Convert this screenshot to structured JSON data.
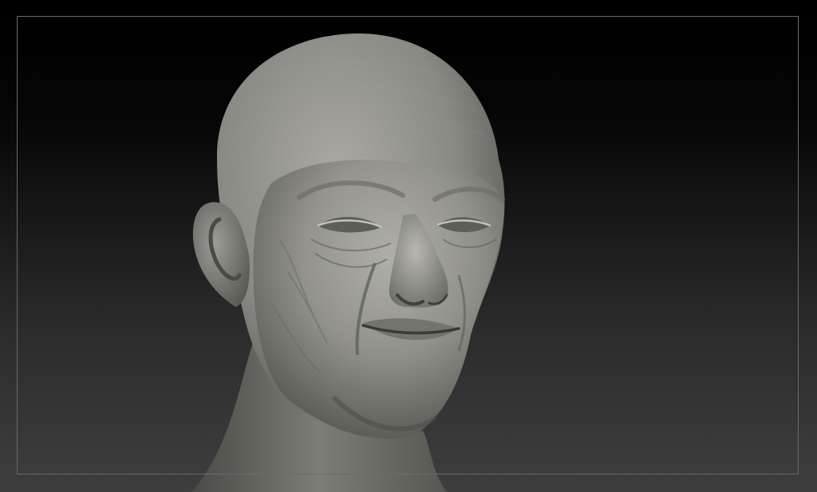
{
  "app": {
    "window_title": ""
  },
  "viewport": {
    "background_top": "#000000",
    "background_bottom": "#3e3e3e",
    "frame_color": "#6a6a6a"
  },
  "model": {
    "material_base": "#8a8a84",
    "material_highlight": "#b4b4ad",
    "material_shadow": "#3c3c38",
    "icon": "sculpted-head-model"
  }
}
